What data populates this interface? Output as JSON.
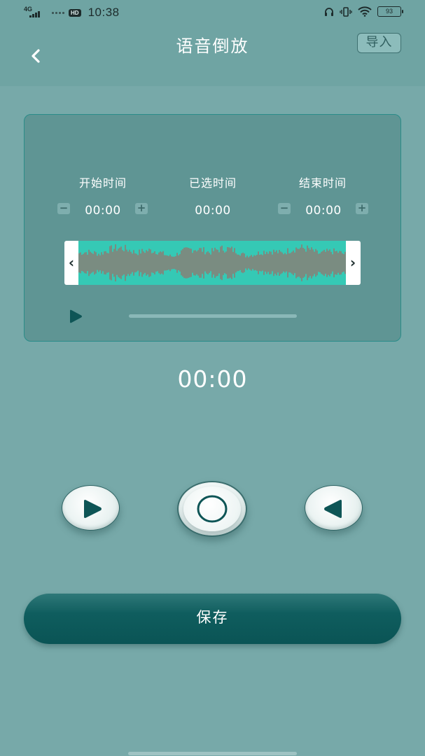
{
  "status_bar": {
    "network": "4G",
    "hd_badge": "HD",
    "time": "10:38",
    "battery": "93"
  },
  "header": {
    "title": "语音倒放",
    "import_label": "导入",
    "back_icon": "chevron-left-icon"
  },
  "trim_panel": {
    "start": {
      "label": "开始时间",
      "value": "00:00",
      "minus": "−",
      "plus": "+"
    },
    "selected": {
      "label": "已选时间",
      "value": "00:00"
    },
    "end": {
      "label": "结束时间",
      "value": "00:00",
      "minus": "−",
      "plus": "+"
    },
    "left_handle": "‹",
    "right_handle": "›",
    "waveform_color": "#c0504d",
    "waveform_bg": "#35c9b5",
    "playback_progress": 0
  },
  "playback_time": "00:00",
  "controls": {
    "play_icon": "play-icon",
    "record_icon": "record-circle-icon",
    "reverse_icon": "reverse-play-icon"
  },
  "save_label": "保存",
  "colors": {
    "background": "#77a9a9",
    "header": "#6fa4a3",
    "accent": "#0f5d5e"
  }
}
